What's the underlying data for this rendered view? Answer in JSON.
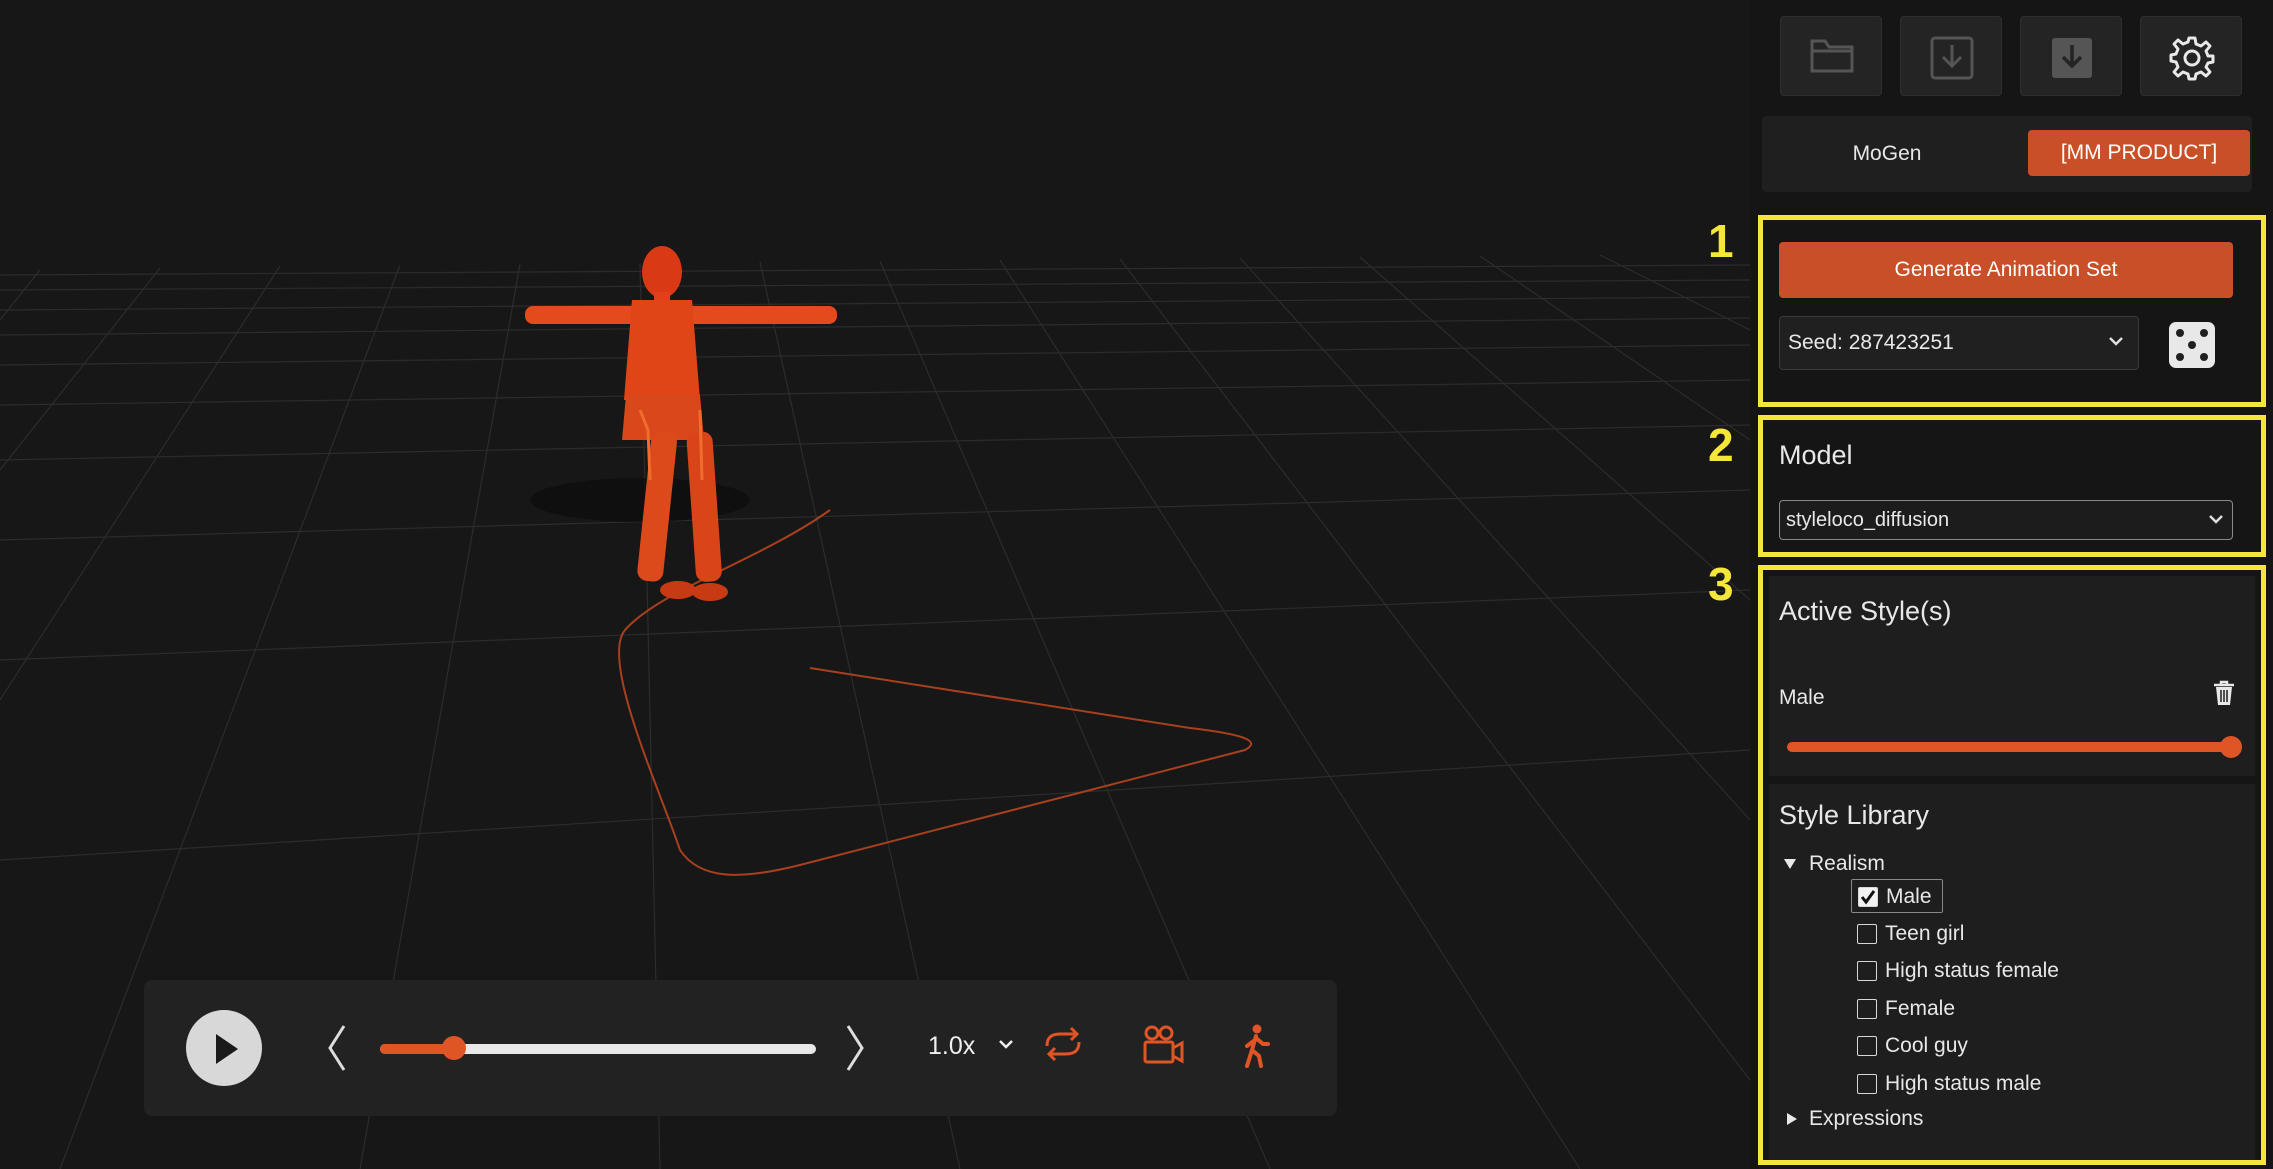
{
  "toolbar": {
    "open_icon": "folder-icon",
    "import_icon": "import-icon",
    "download_icon": "download-icon",
    "settings_icon": "gear-icon"
  },
  "tabs": [
    {
      "label": "MoGen",
      "active": false
    },
    {
      "label": "[MM PRODUCT]",
      "active": true
    }
  ],
  "annotations": [
    "1",
    "2",
    "3"
  ],
  "generate": {
    "button_label": "Generate Animation Set",
    "seed_label": "Seed: 287423251"
  },
  "model": {
    "title": "Model",
    "selected": "styleloco_diffusion"
  },
  "active_styles": {
    "title": "Active Style(s)",
    "items": [
      {
        "name": "Male",
        "weight": 1.0
      }
    ]
  },
  "style_library": {
    "title": "Style Library",
    "groups": [
      {
        "name": "Realism",
        "expanded": true,
        "items": [
          {
            "label": "Male",
            "checked": true
          },
          {
            "label": "Teen girl",
            "checked": false
          },
          {
            "label": "High status female",
            "checked": false
          },
          {
            "label": "Female",
            "checked": false
          },
          {
            "label": "Cool guy",
            "checked": false
          },
          {
            "label": "High status male",
            "checked": false
          }
        ]
      },
      {
        "name": "Expressions",
        "expanded": false,
        "items": []
      }
    ]
  },
  "playback": {
    "progress": 0.17,
    "speed": "1.0x",
    "play_icon": "play-icon",
    "loop_icon": "loop-icon",
    "camera_icon": "camera-icon",
    "walk_icon": "walk-icon"
  },
  "colors": {
    "accent": "#c84f27",
    "highlight": "#f5e63a",
    "character": "#e0401a"
  }
}
